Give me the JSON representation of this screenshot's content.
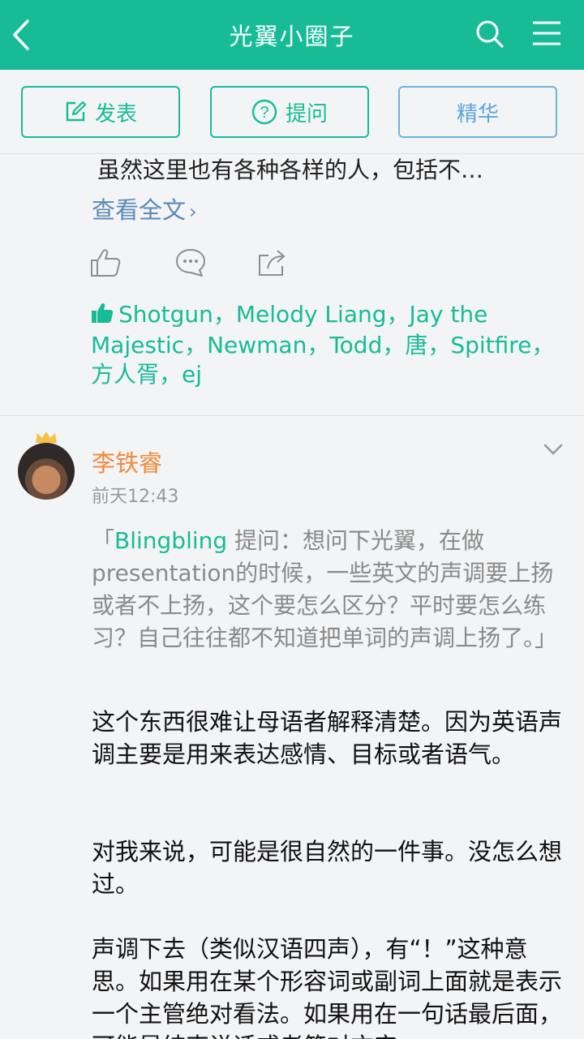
{
  "header": {
    "title": "光翼小圈子",
    "back_icon": "back-chevron-icon",
    "search_icon": "search-icon",
    "menu_icon": "hamburger-menu-icon",
    "color": "#17bc97"
  },
  "actions": {
    "post_label": "发表",
    "ask_label": "提问",
    "featured_label": "精华"
  },
  "post1": {
    "excerpt": "虽然这里也有各种各样的人，包括不…",
    "read_more": "查看全文",
    "likers": "Shotgun，Melody Liang，Jay the Majestic，Newman，Todd，唐，Spitfire，方人胥，ej"
  },
  "post2": {
    "author": "李铁睿",
    "time": "前天12:43",
    "quote_open": "「",
    "quote_user": "Blingbling",
    "quote_text": " 提问：想问下光翼，在做presentation的时候，一些英文的声调要上扬或者不上扬，这个要怎么区分？平时要怎么练习？自己往往都不知道把单词的声调上扬了。」",
    "paragraphs": [
      "这个东西很难让母语者解释清楚。因为英语声调主要是用来表达感情、目标或者语气。",
      "对我来说，可能是很自然的一件事。没怎么想过。",
      "声调下去（类似汉语四声），有“！”这种意思。如果用在某个形容词或副词上面就是表示一个主管绝对看法。如果用在一句话最后面，可能是结束说话或者简对方实"
    ]
  }
}
